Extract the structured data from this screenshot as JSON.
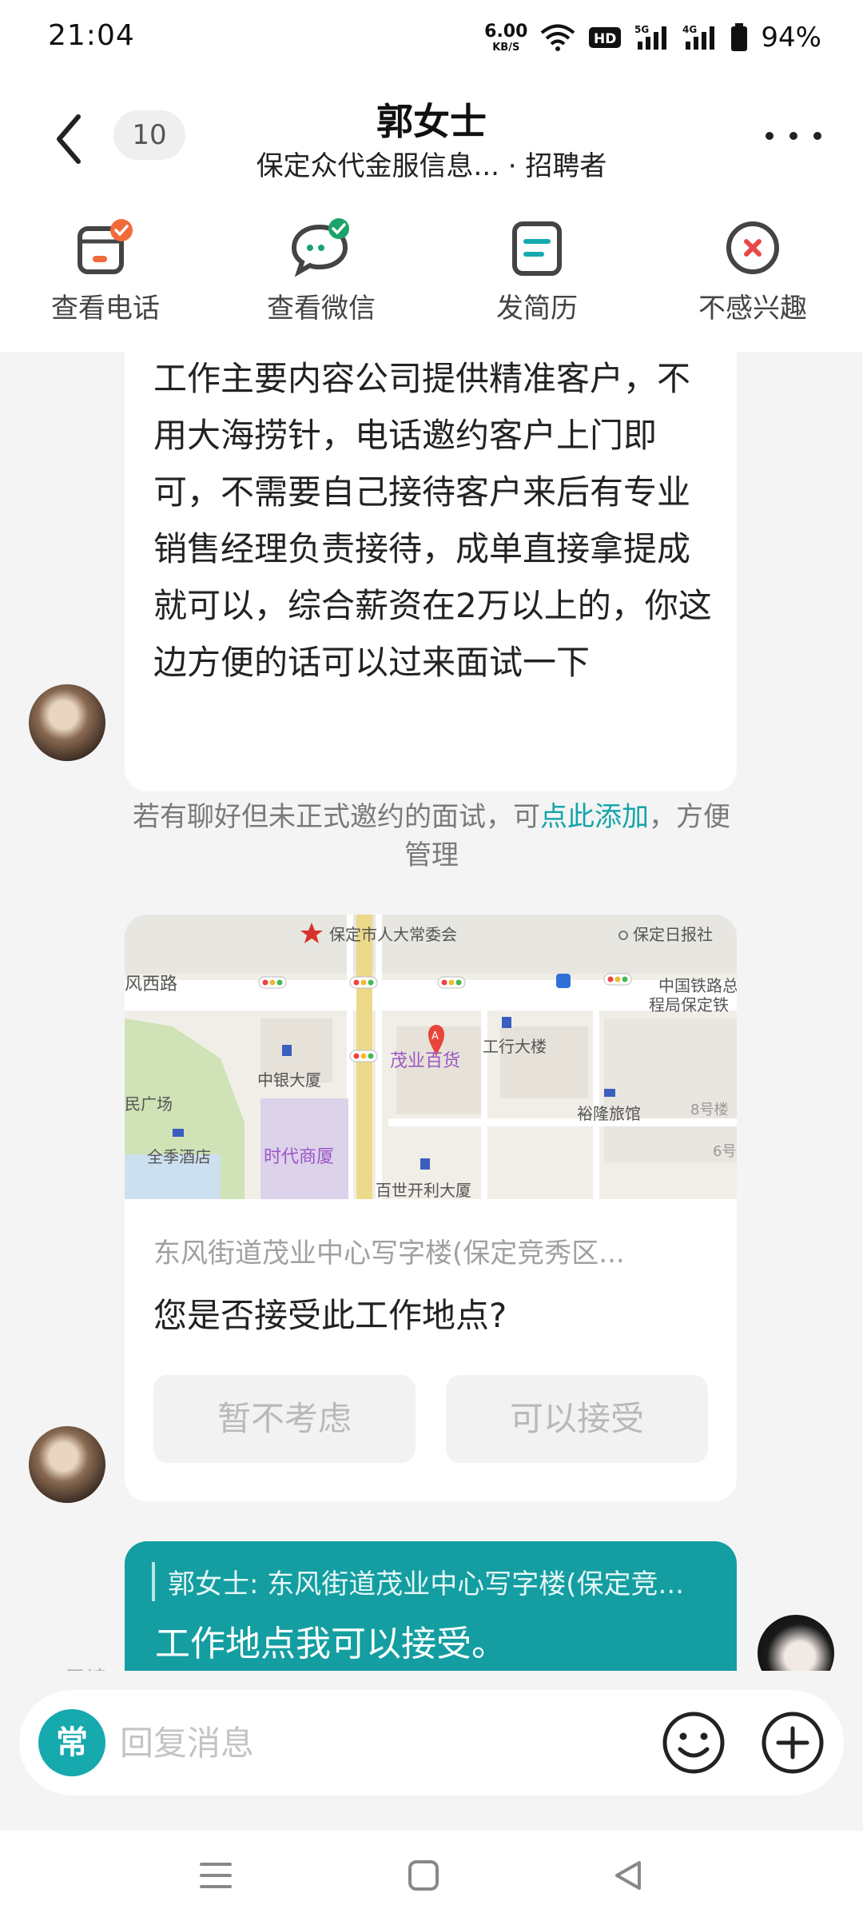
{
  "status_bar": {
    "time": "21:04",
    "net_speed_value": "6.00",
    "net_speed_unit": "KB/S",
    "hd_label": "HD",
    "signal1_label": "5G",
    "signal2_label": "4G",
    "battery": "94%"
  },
  "header": {
    "unread_count": "10",
    "title": "郭女士",
    "subtitle": "保定众代金服信息... · 招聘者"
  },
  "actions": [
    {
      "label": "查看电话",
      "icon": "phone-card-icon"
    },
    {
      "label": "查看微信",
      "icon": "wechat-icon"
    },
    {
      "label": "发简历",
      "icon": "resume-icon"
    },
    {
      "label": "不感兴趣",
      "icon": "not-interested-icon"
    }
  ],
  "messages": {
    "recruiter_text": "工作主要内容公司提供精准客户，不用大海捞针，电话邀约客户上门即可，不需要自己接待客户来后有专业销售经理负责接待，成单直接拿提成就可以，综合薪资在2万以上的，你这边方便的话可以过来面试一下",
    "system_note_prefix": "若有聊好但未正式邀约的面试，可",
    "system_note_link": "点此添加",
    "system_note_suffix": "，方便管理",
    "location_card": {
      "map_labels": {
        "l1": "保定市人大常委会",
        "l2": "保定日报社",
        "l3": "风西路",
        "l4": "中国铁路总",
        "l5": "程局保定铁",
        "l6": "茂业百货",
        "l7": "工行大楼",
        "l8": "中银大厦",
        "l9": "民广场",
        "l10": "裕隆旅馆",
        "l11": "8号楼",
        "l12": "全季酒店",
        "l13": "时代商厦",
        "l14": "6号",
        "l15": "百世开利大厦",
        "pin": "A"
      },
      "address": "东风街道茂业中心写字楼(保定竞秀区...",
      "question": "您是否接受此工作地点?",
      "decline_label": "暂不考虑",
      "accept_label": "可以接受"
    },
    "my_reply_quote": "郭女士: 东风街道茂业中心写字楼(保定竞...",
    "my_reply_text": "工作地点我可以接受。",
    "read_tag": "已读"
  },
  "input": {
    "quick_label": "常",
    "placeholder": "回复消息"
  },
  "colors": {
    "accent": "#16a9ad",
    "my_bubble": "#149ea1",
    "link": "#12a5a8"
  }
}
